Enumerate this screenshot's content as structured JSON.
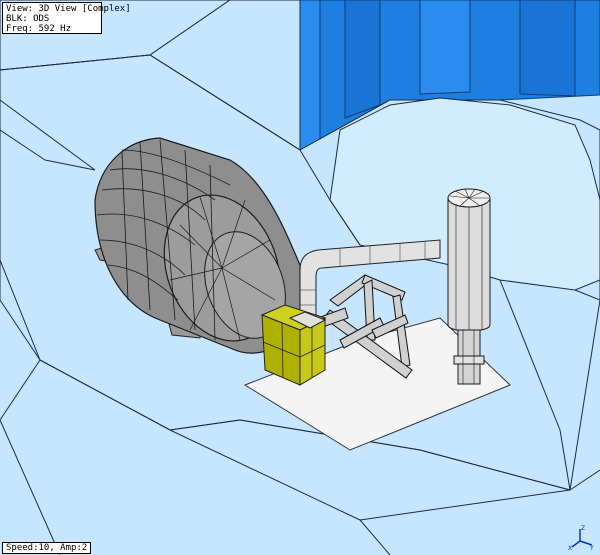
{
  "view_info": {
    "view_label": "View: 3D View [Complex]",
    "block_label": "BLK: ODS",
    "freq_label": "Freq: 592 Hz"
  },
  "status_bar": {
    "animation_label": "Speed:10, Amp:2"
  },
  "axis_triad": {
    "x_label": "X",
    "y_label": "Y",
    "z_label": "Z"
  },
  "colors": {
    "wall_blue": "#1f7fe0",
    "floor_blue": "#c6e6ff",
    "floor_lines": "#1c2c40",
    "model_gray": "#9a9a9a",
    "pipe_light": "#e2e2e2",
    "highlight_yellow": "#b0b000",
    "base_plate": "#f4f4f4"
  },
  "scene_objects": [
    "room-floor",
    "room-walls",
    "turbine-housing",
    "exhaust-pipe",
    "pipe-supports",
    "yellow-block",
    "vertical-stack",
    "base-plate"
  ]
}
